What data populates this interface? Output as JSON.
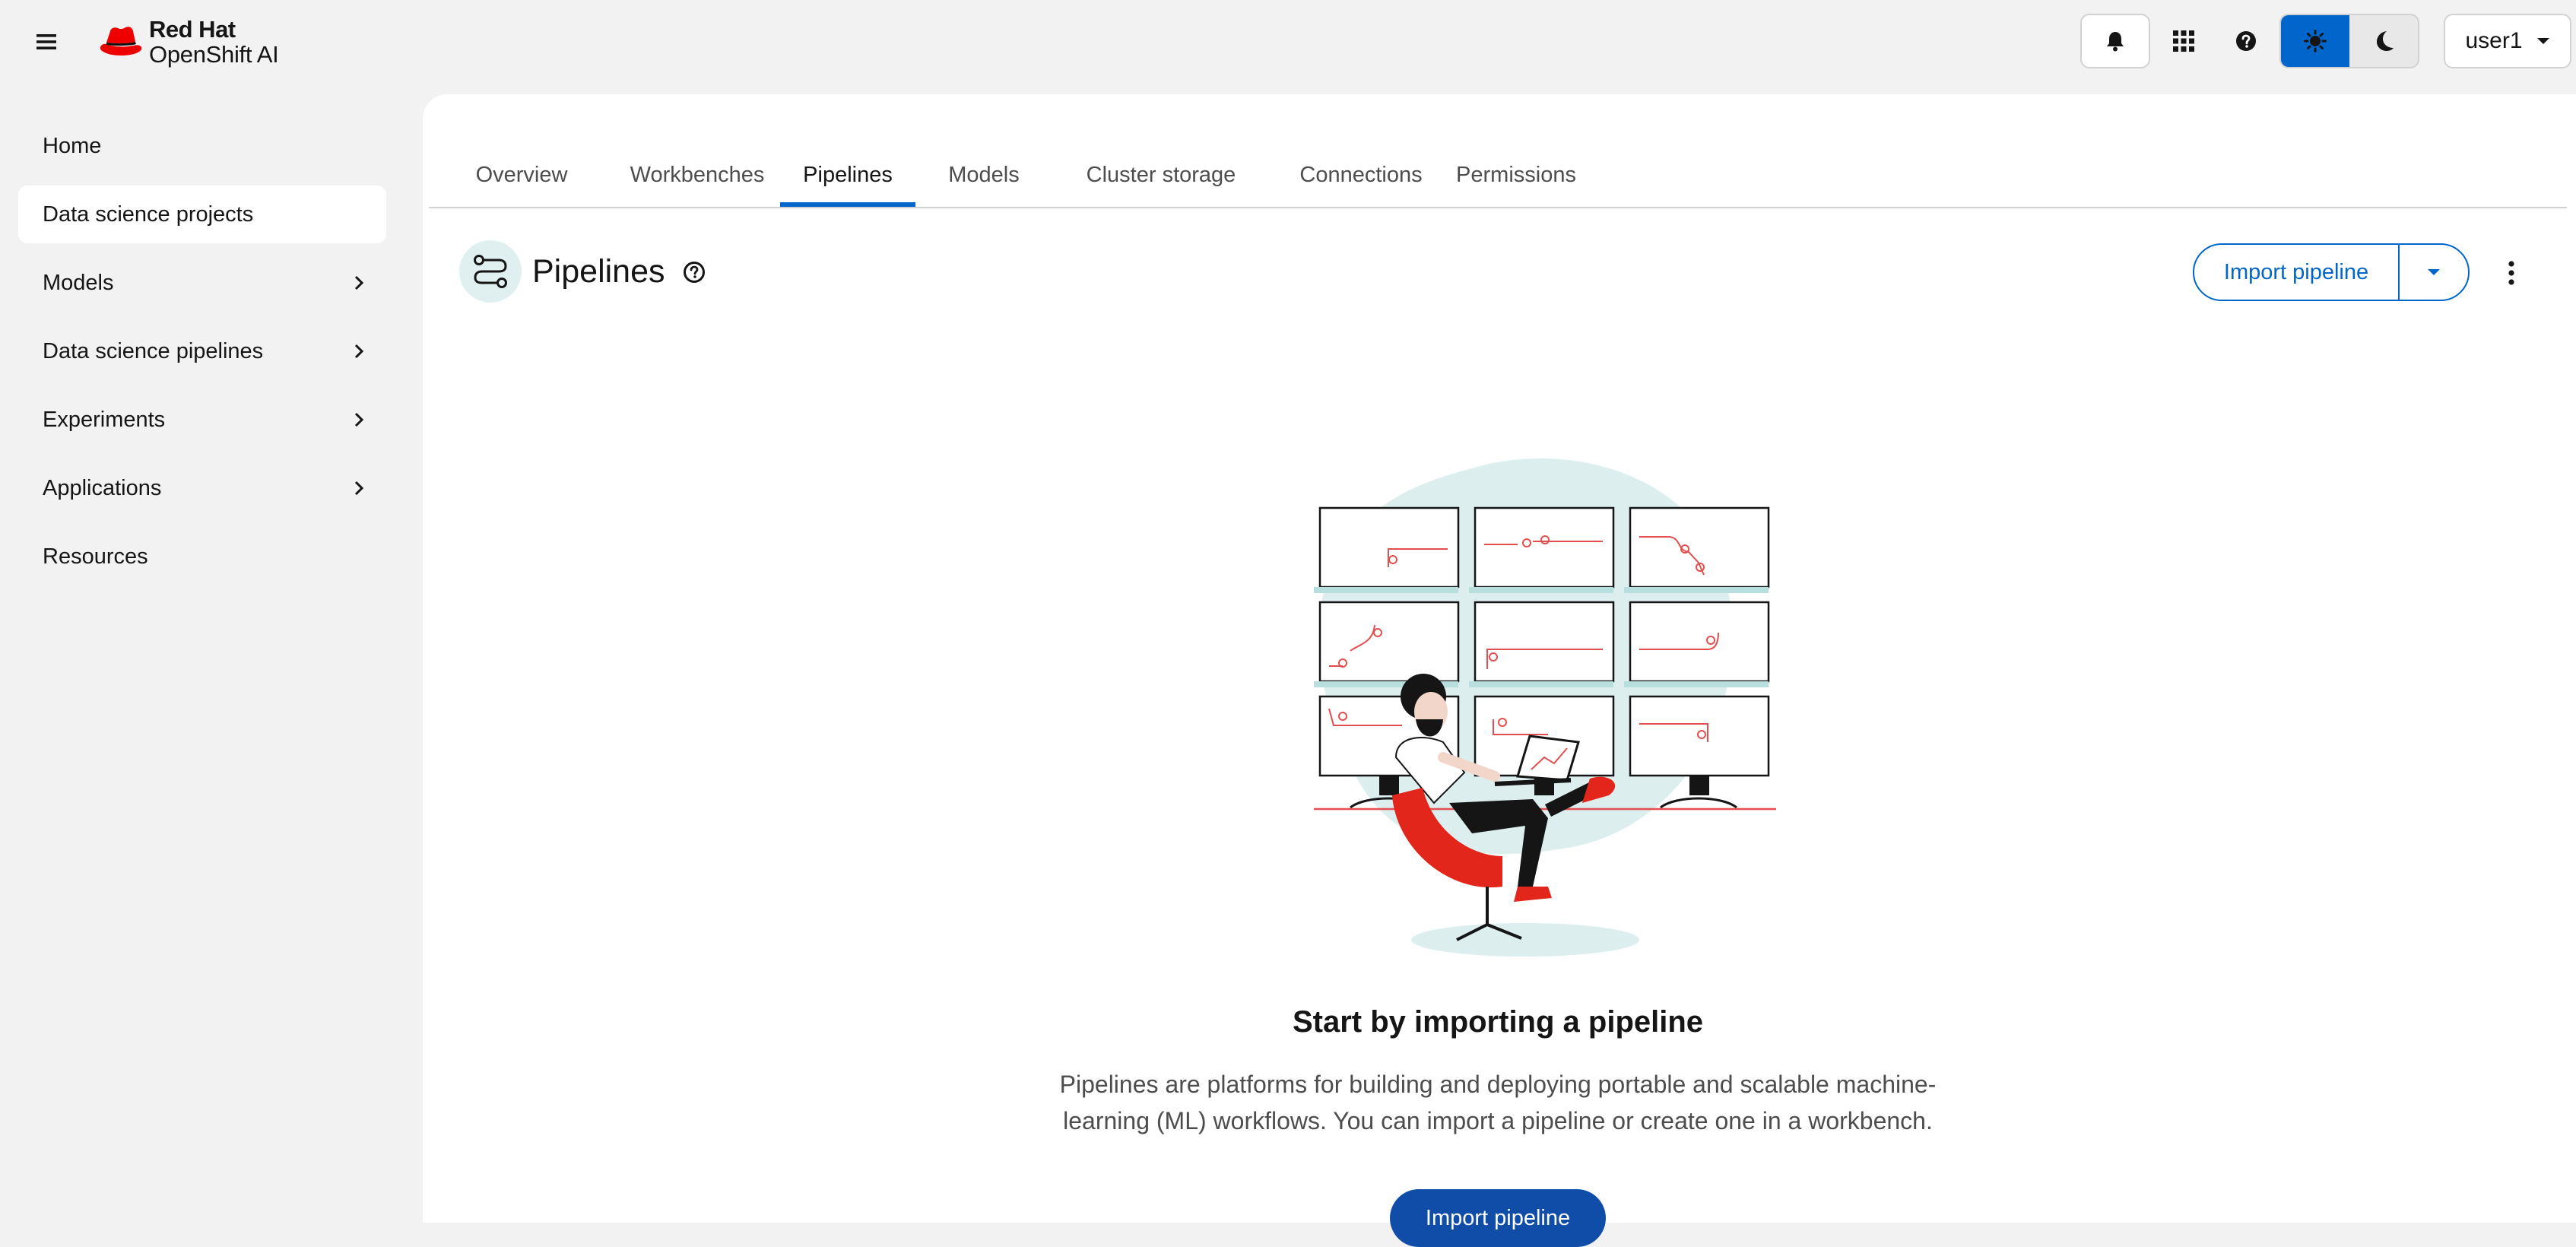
{
  "brand": {
    "company": "Red Hat",
    "product": "OpenShift AI"
  },
  "masthead": {
    "user_label": "user1",
    "theme_options": [
      "light",
      "dark"
    ],
    "theme_selected": "light"
  },
  "sidebar": {
    "items": [
      {
        "label": "Home",
        "expandable": false,
        "active": false
      },
      {
        "label": "Data science projects",
        "expandable": false,
        "active": true
      },
      {
        "label": "Models",
        "expandable": true,
        "active": false
      },
      {
        "label": "Data science pipelines",
        "expandable": true,
        "active": false
      },
      {
        "label": "Experiments",
        "expandable": true,
        "active": false
      },
      {
        "label": "Applications",
        "expandable": true,
        "active": false
      },
      {
        "label": "Resources",
        "expandable": false,
        "active": false
      }
    ]
  },
  "tabs": [
    {
      "label": "Overview",
      "active": false
    },
    {
      "label": "Workbenches",
      "active": false
    },
    {
      "label": "Pipelines",
      "active": true
    },
    {
      "label": "Models",
      "active": false
    },
    {
      "label": "Cluster storage",
      "active": false
    },
    {
      "label": "Connections",
      "active": false
    },
    {
      "label": "Permissions",
      "active": false
    }
  ],
  "page": {
    "title": "Pipelines",
    "import_button_label": "Import pipeline"
  },
  "empty_state": {
    "title": "Start by importing a pipeline",
    "body": "Pipelines are platforms for building and deploying portable and scalable machine-learning (ML) workflows. You can import a pipeline or create one in a workbench.",
    "button_label": "Import pipeline"
  },
  "colors": {
    "accent": "#0066cc",
    "primary_button": "#0f4da8",
    "brand_red": "#ee0000",
    "illustration_bg": "#dceeee"
  }
}
